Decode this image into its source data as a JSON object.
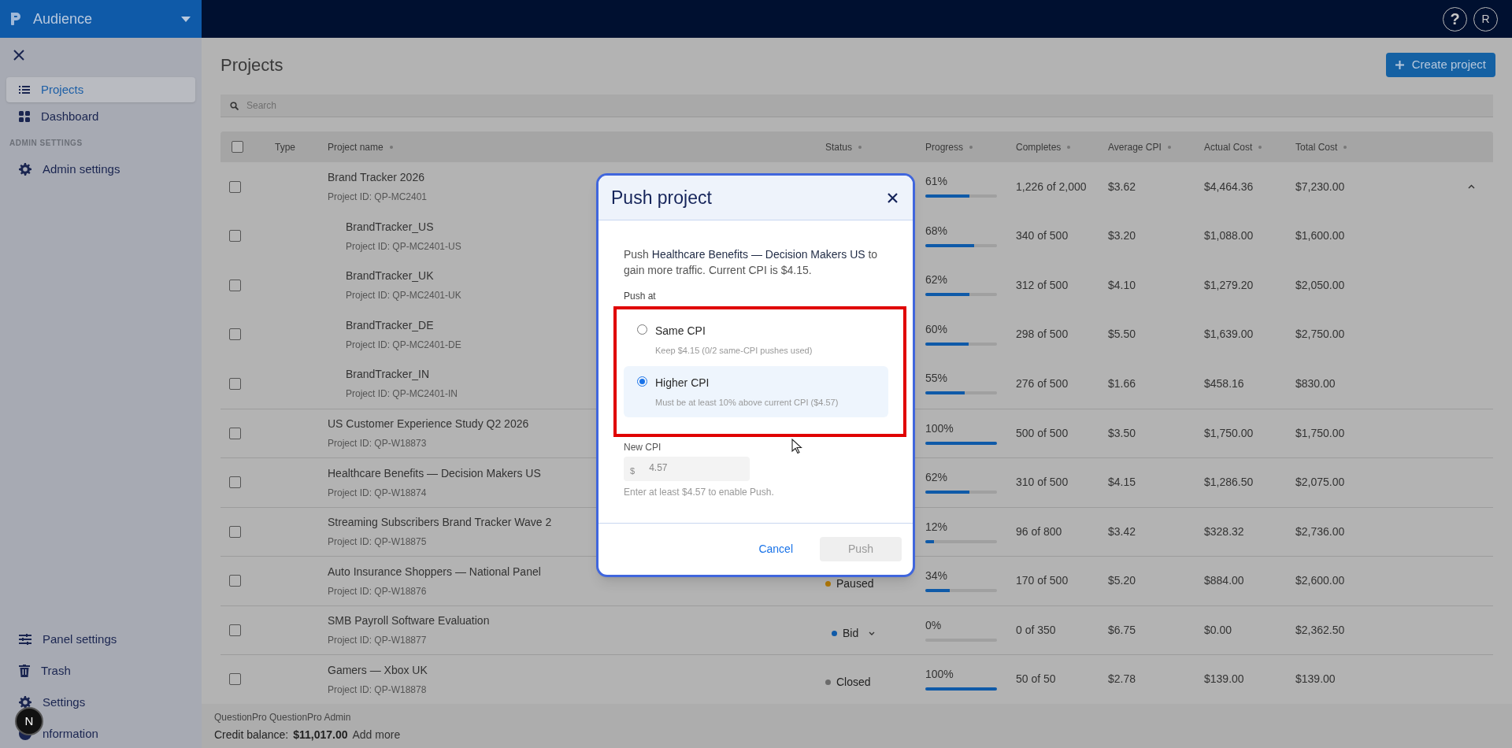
{
  "app_switcher": {
    "label": "Audience"
  },
  "sidebar": {
    "items": [
      {
        "label": "Projects",
        "selected": true
      },
      {
        "label": "Dashboard",
        "selected": false
      }
    ],
    "section_heading": "ADMIN SETTINGS",
    "admin_items": [
      {
        "label": "Admin settings",
        "selected": false
      }
    ],
    "bottom_items": [
      {
        "label": "Panel settings",
        "selected": false
      },
      {
        "label": "Trash",
        "selected": false
      },
      {
        "label": "Settings",
        "selected": false
      },
      {
        "label": "nformation",
        "selected": false
      }
    ],
    "dev_badge": "N"
  },
  "top_bar": {
    "help": "?",
    "avatar": "R"
  },
  "page": {
    "title": "Projects",
    "create_button": "Create project",
    "search": {
      "placeholder": "Search"
    }
  },
  "table": {
    "select_all_checked": false,
    "columns": [
      "Type",
      "Project name",
      "Status",
      "Progress",
      "Completes",
      "Average CPI",
      "Actual Cost",
      "Total Cost"
    ],
    "rows": [
      {
        "name": "Brand Tracker 2026",
        "project_id": "Project ID: QP-MC2401",
        "checked": false,
        "expanded": true,
        "progress": "61%",
        "level": 0.61,
        "completes": "1,226 of 2,000",
        "average_cpi": "$3.62",
        "actual_cost": "$4,464.36",
        "total_cost": "$7,230.00",
        "children": [
          {
            "name": "BrandTracker_US",
            "project_id": "Project ID: QP-MC2401-US",
            "checked": false,
            "progress": "68%",
            "level": 0.68,
            "completes": "340 of 500",
            "average_cpi": "$3.20",
            "actual_cost": "$1,088.00",
            "total_cost": "$1,600.00"
          },
          {
            "name": "BrandTracker_UK",
            "project_id": "Project ID: QP-MC2401-UK",
            "checked": false,
            "progress": "62%",
            "level": 0.62,
            "completes": "312 of 500",
            "average_cpi": "$4.10",
            "actual_cost": "$1,279.20",
            "total_cost": "$2,050.00"
          },
          {
            "name": "BrandTracker_DE",
            "project_id": "Project ID: QP-MC2401-DE",
            "checked": false,
            "progress": "60%",
            "level": 0.6,
            "completes": "298 of 500",
            "average_cpi": "$5.50",
            "actual_cost": "$1,639.00",
            "total_cost": "$2,750.00"
          },
          {
            "name": "BrandTracker_IN",
            "project_id": "Project ID: QP-MC2401-IN",
            "checked": false,
            "progress": "55%",
            "level": 0.55,
            "completes": "276 of 500",
            "average_cpi": "$1.66",
            "actual_cost": "$458.16",
            "total_cost": "$830.00"
          }
        ]
      },
      {
        "name": "US Customer Experience Study Q2 2026",
        "project_id": "Project ID: QP-W18873",
        "checked": false,
        "progress": "100%",
        "level": 1,
        "completes": "500 of 500",
        "average_cpi": "$3.50",
        "actual_cost": "$1,750.00",
        "total_cost": "$1,750.00"
      },
      {
        "name": "Healthcare Benefits — Decision Makers US",
        "project_id": "Project ID: QP-W18874",
        "checked": false,
        "progress": "62%",
        "level": 0.62,
        "completes": "310 of 500",
        "average_cpi": "$4.15",
        "actual_cost": "$1,286.50",
        "total_cost": "$2,075.00"
      },
      {
        "name": "Streaming Subscribers Brand Tracker Wave 2",
        "project_id": "Project ID: QP-W18875",
        "checked": false,
        "progress": "12%",
        "level": 0.12,
        "completes": "96 of 800",
        "average_cpi": "$3.42",
        "actual_cost": "$328.32",
        "total_cost": "$2,736.00"
      },
      {
        "name": "Auto Insurance Shoppers — National Panel",
        "project_id": "Project ID: QP-W18876",
        "checked": false,
        "status": {
          "label": "Paused",
          "color": "#b07808",
          "dropdown": false
        },
        "progress": "34%",
        "level": 0.34,
        "completes": "170 of 500",
        "average_cpi": "$5.20",
        "actual_cost": "$884.00",
        "total_cost": "$2,600.00"
      },
      {
        "name": "SMB Payroll Software Evaluation",
        "project_id": "Project ID: QP-W18877",
        "checked": false,
        "status": {
          "label": "Bid",
          "color": "#0f5aa8",
          "dropdown": true
        },
        "progress": "0%",
        "level": 0,
        "completes": "0 of 350",
        "average_cpi": "$6.75",
        "actual_cost": "$0.00",
        "total_cost": "$2,362.50"
      },
      {
        "name": "Gamers — Xbox UK",
        "project_id": "Project ID: QP-W18878",
        "checked": false,
        "status": {
          "label": "Closed",
          "color": "#6b6b6b",
          "dropdown": false
        },
        "progress": "100%",
        "level": 1,
        "completes": "50 of 50",
        "average_cpi": "$2.78",
        "actual_cost": "$139.00",
        "total_cost": "$139.00"
      }
    ]
  },
  "footer": {
    "account": "QuestionPro QuestionPro Admin",
    "credit_label": "Credit balance:",
    "credit_value": "$11,017.00",
    "add_more": "Add more"
  },
  "dialog": {
    "title": "Push project",
    "message": "Push **Healthcare Benefits — Decision Makers US** to gain more traffic. Current CPI is $4.15.",
    "push_at_label": "Push at",
    "options": [
      {
        "label": "Same CPI",
        "hint": "Keep $4.15 (0/2 same-CPI pushes used)",
        "selected": false
      },
      {
        "label": "Higher CPI",
        "hint": "Must be at least 10% above current CPI ($4.57)",
        "selected": true
      }
    ],
    "new_cpi": {
      "label": "New CPI",
      "prefix": "$",
      "value": "4.57",
      "disabled": true,
      "help": "Enter at least $4.57 to enable Push."
    },
    "cancel": "Cancel",
    "push": {
      "label": "Push",
      "disabled": true
    }
  }
}
